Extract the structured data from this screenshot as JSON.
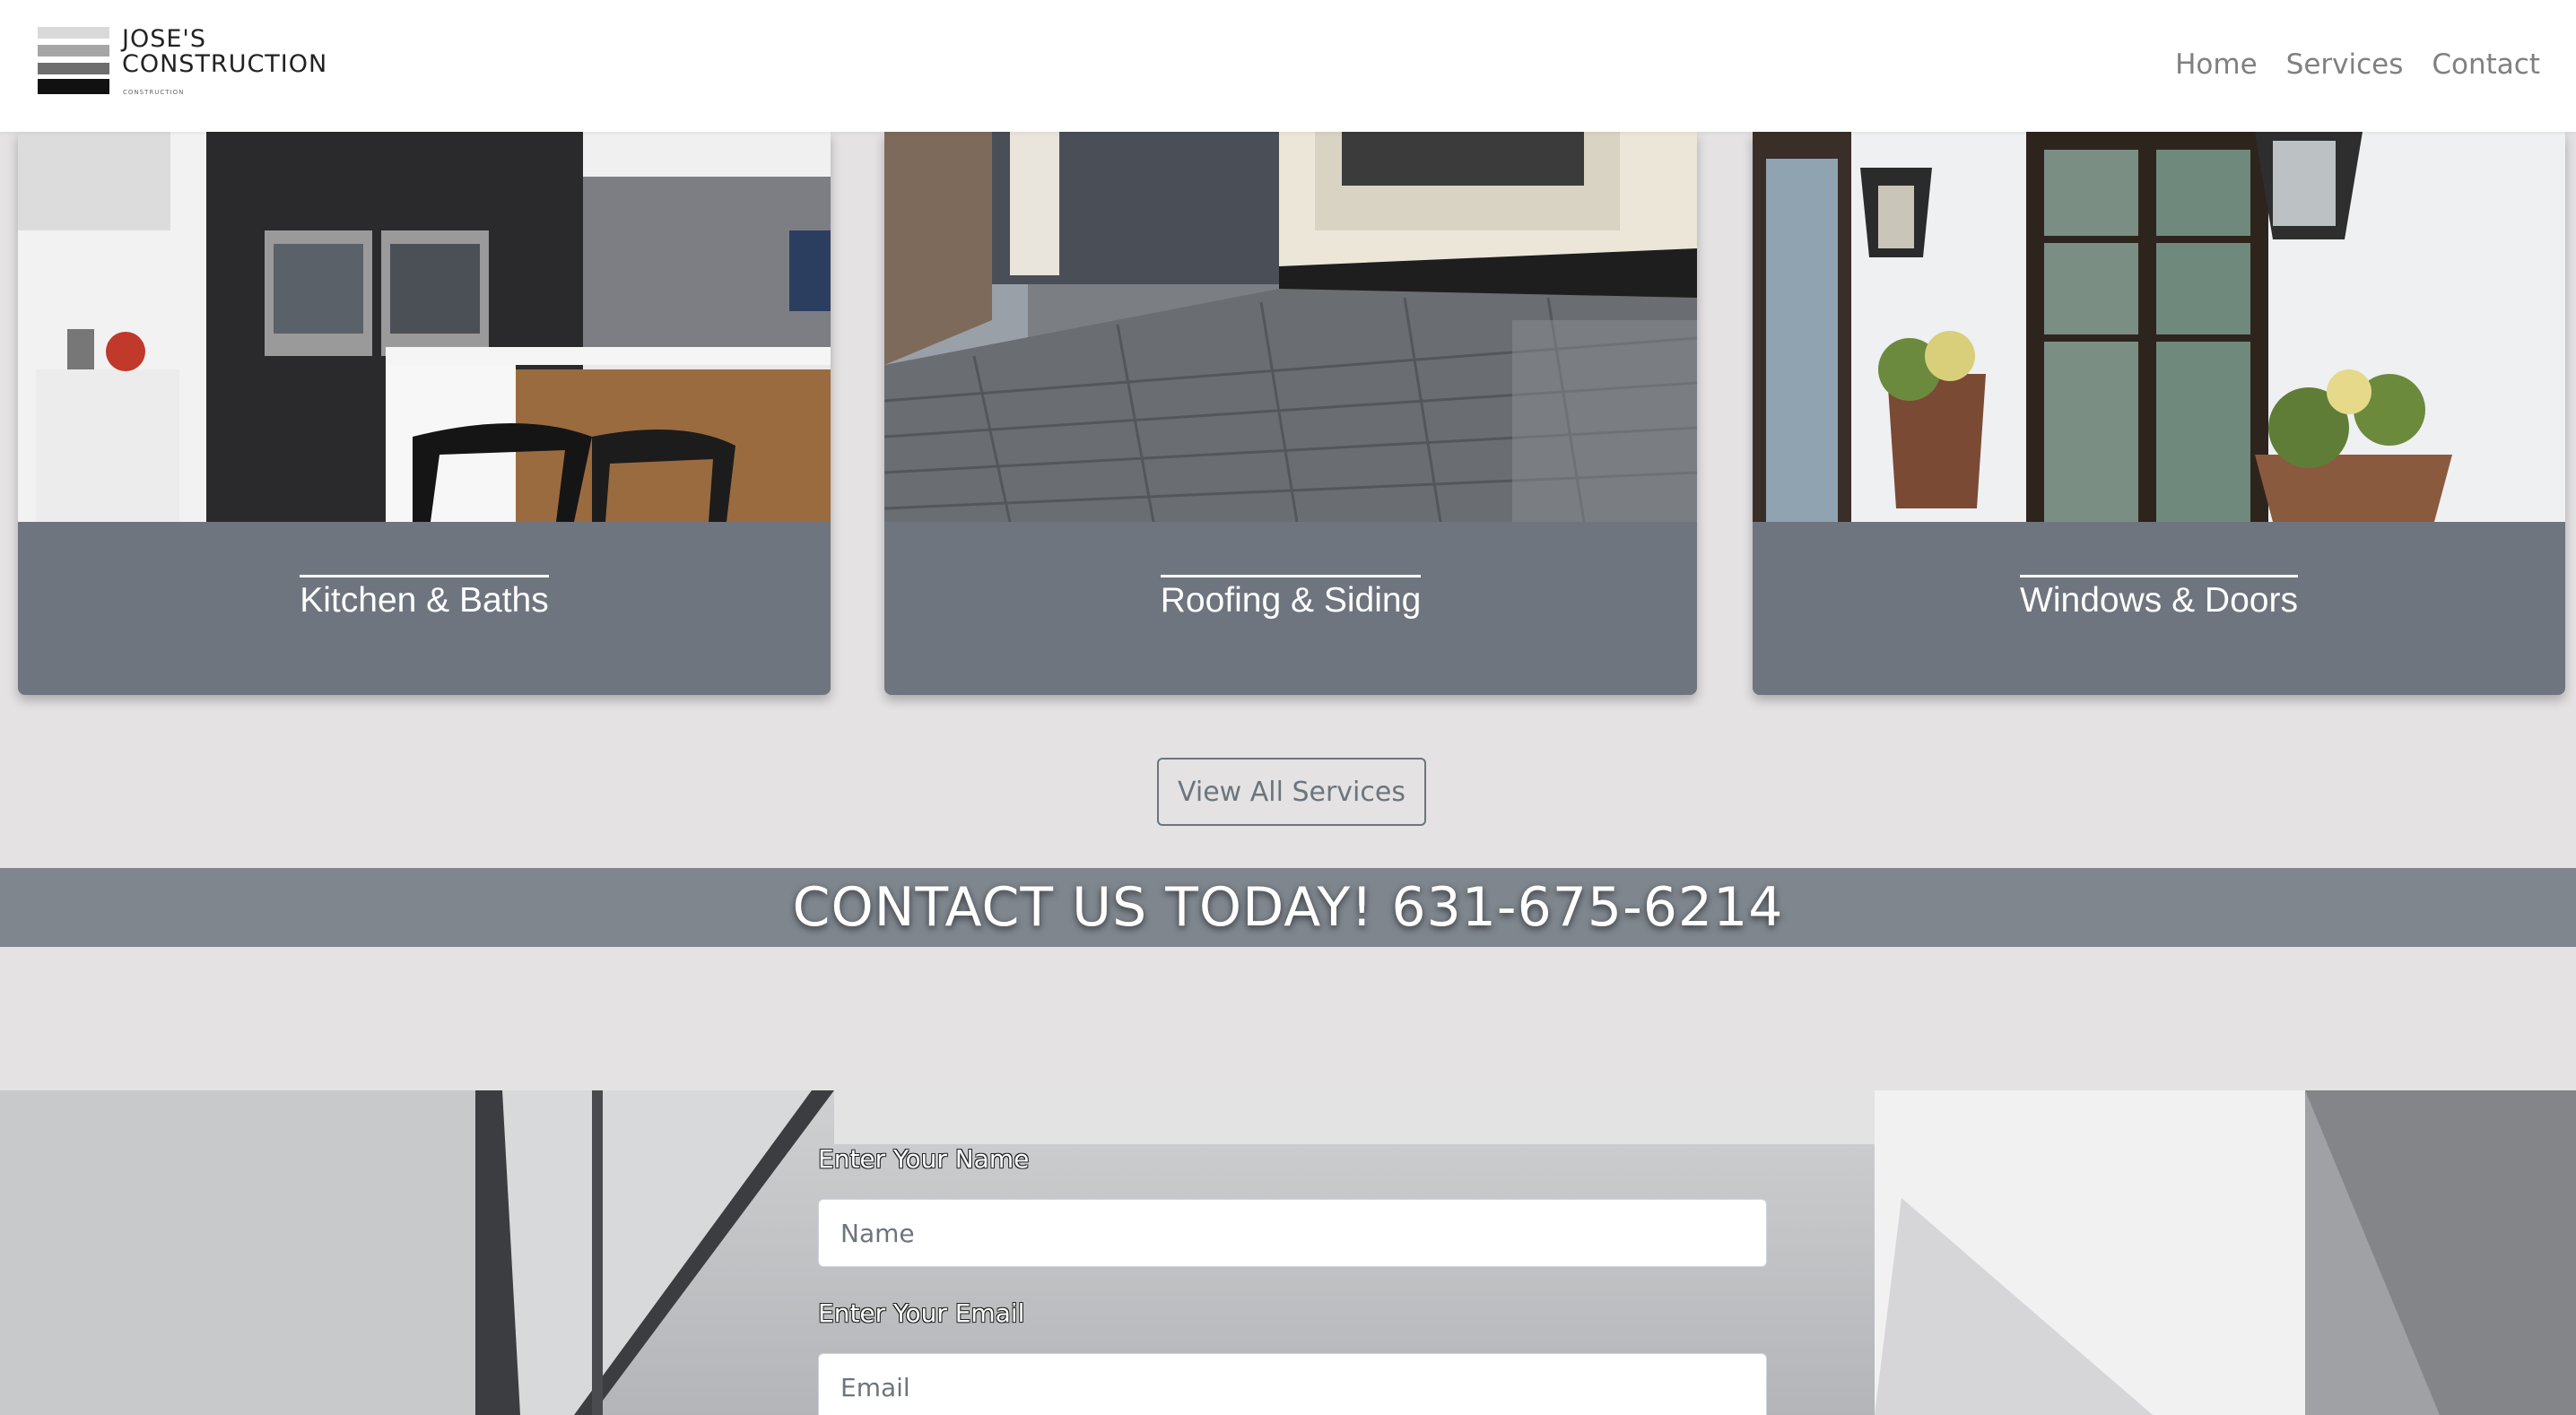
{
  "brand": {
    "name_line1": "JOSE'S",
    "name_line2": "CONSTRUCTION",
    "tagline": "CONSTRUCTION"
  },
  "nav": {
    "items": [
      {
        "label": "Home"
      },
      {
        "label": "Services"
      },
      {
        "label": "Contact"
      }
    ]
  },
  "services": {
    "cards": [
      {
        "title": "Kitchen & Baths",
        "image": "kitchen-photo"
      },
      {
        "title": "Roofing & Siding",
        "image": "roof-photo"
      },
      {
        "title": "Windows & Doors",
        "image": "door-photo"
      }
    ],
    "view_all_label": "View All Services"
  },
  "contact_banner": {
    "text": "CONTACT US TODAY! 631-675-6214"
  },
  "form": {
    "name_label": "Enter Your Name",
    "name_placeholder": "Name",
    "email_label": "Enter Your Email",
    "email_placeholder": "Email"
  },
  "colors": {
    "card_bg": "#6f757e",
    "banner_bg": "#7f868e",
    "page_bg": "#e4e2e3",
    "nav_link": "#808080"
  }
}
